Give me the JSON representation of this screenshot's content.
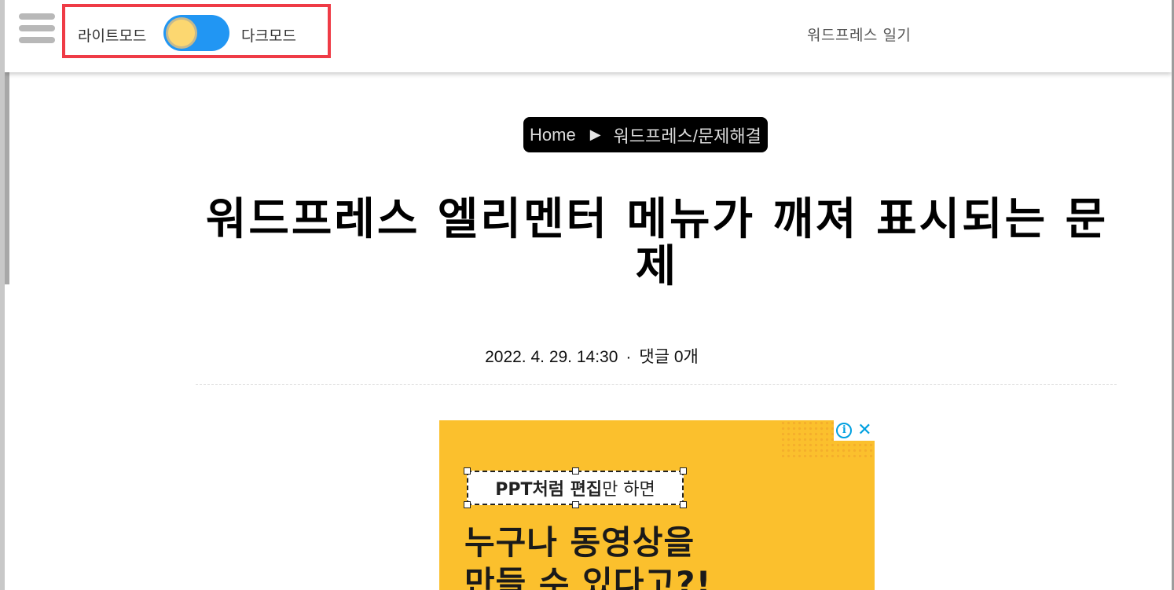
{
  "header": {
    "menu_icon": "hamburger-menu-icon",
    "mode_light_label": "라이트모드",
    "mode_dark_label": "다크모드",
    "toggle_state": "light",
    "site_title": "워드프레스 일기",
    "highlight_color": "#ef3b46",
    "toggle_track_color": "#2196f3",
    "toggle_knob_color": "#fcd770"
  },
  "breadcrumb": {
    "home": "Home",
    "separator_icon": "play-arrow-icon",
    "separator": "▶",
    "category": "워드프레스/문제해결"
  },
  "post": {
    "title": "워드프레스 엘리멘터 메뉴가 깨져 표시되는 문제",
    "date": "2022. 4. 29. 14:30",
    "meta_separator": "·",
    "comments": "댓글 0개"
  },
  "ad": {
    "info_icon": "info-icon",
    "info_glyph": "i",
    "close_icon": "close-icon",
    "close_glyph": "✕",
    "edit_bold": "PPT처럼 편집",
    "edit_rest": "만 하면",
    "headline": "누구나 동영상을\n만들 수 있다고?!",
    "background_color": "#fbc02d"
  }
}
